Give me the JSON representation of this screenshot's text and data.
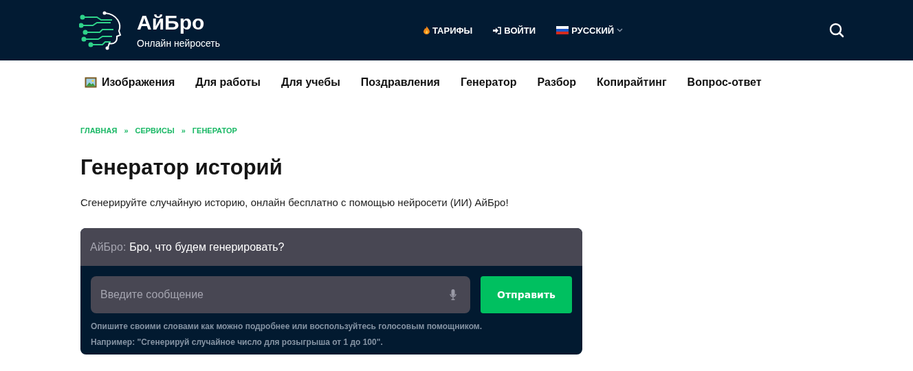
{
  "header": {
    "logo_title": "АйБро",
    "logo_subtitle": "Онлайн нейросеть",
    "nav": [
      {
        "kind": "tariffs",
        "label": "ТАРИФЫ"
      },
      {
        "kind": "login",
        "label": "ВОЙТИ"
      },
      {
        "kind": "language",
        "label": "РУССКИЙ"
      }
    ]
  },
  "menu": [
    {
      "kind": "image",
      "label": "Изображения"
    },
    {
      "kind": "plain",
      "label": "Для работы"
    },
    {
      "kind": "plain",
      "label": "Для учебы"
    },
    {
      "kind": "plain",
      "label": "Поздравления"
    },
    {
      "kind": "plain",
      "label": "Генератор"
    },
    {
      "kind": "plain",
      "label": "Разбор"
    },
    {
      "kind": "plain",
      "label": "Копирайтинг"
    },
    {
      "kind": "plain",
      "label": "Вопрос-ответ"
    }
  ],
  "breadcrumbs": [
    "ГЛАВНАЯ",
    "СЕРВИСЫ",
    "ГЕНЕРАТОР"
  ],
  "breadcrumb_separator": "»",
  "title": "Генератор историй",
  "description": "Сгенерируйте случайную историю, онлайн бесплатно с помощью нейросети (ИИ) АйБро!",
  "chat": {
    "speaker": "АйБро:",
    "message": "Бро, что будем генерировать?",
    "input": {
      "placeholder": "Введите сообщение"
    },
    "send_button": "Отправить",
    "hints": [
      "Опишите своими словами как можно подробнее или воспользуйтесь голосовым помощником.",
      "Например: \"Сгенерируй случайное число для розыгрыша от 1 до 100\"."
    ]
  }
}
